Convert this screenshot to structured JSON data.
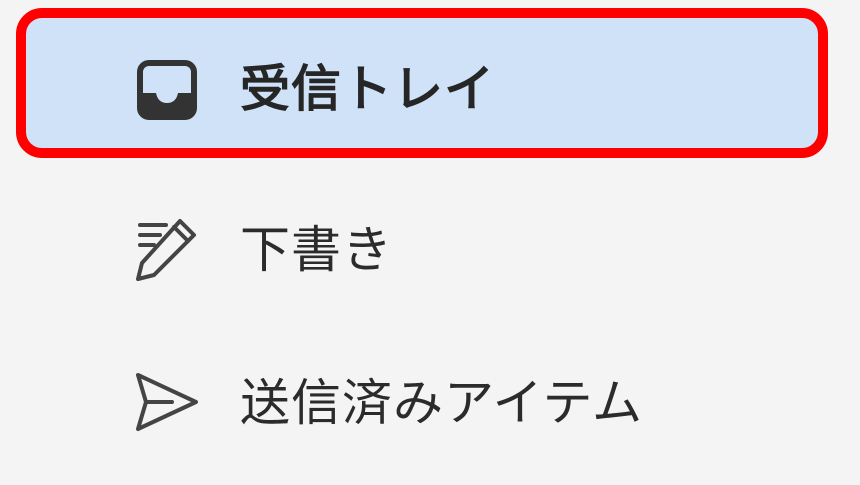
{
  "nav": {
    "items": [
      {
        "label": "受信トレイ",
        "icon": "inbox-icon",
        "selected": true
      },
      {
        "label": "下書き",
        "icon": "pencil-icon",
        "selected": false
      },
      {
        "label": "送信済みアイテム",
        "icon": "send-icon",
        "selected": false
      }
    ]
  },
  "colors": {
    "background": "#f4f4f4",
    "selected_background": "#cfe2f8",
    "highlight_border": "#ff0000",
    "text": "#2b2b2b"
  }
}
